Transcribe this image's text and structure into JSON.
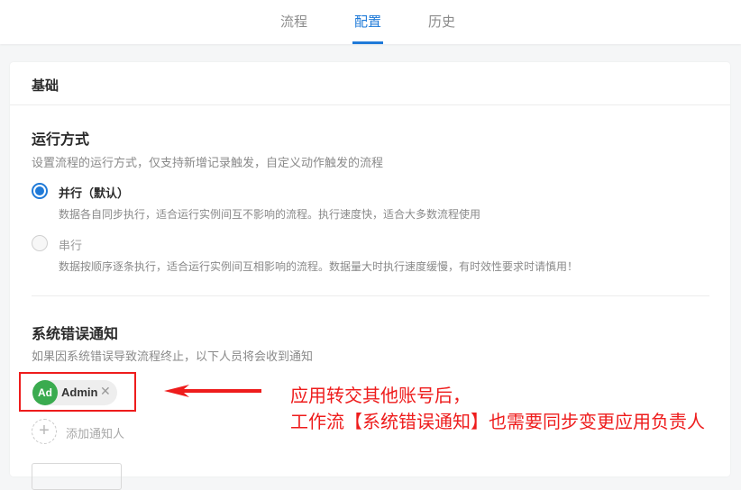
{
  "tabs": [
    {
      "label": "流程",
      "active": false
    },
    {
      "label": "配置",
      "active": true
    },
    {
      "label": "历史",
      "active": false
    }
  ],
  "accent_color": "#1f7ad8",
  "card": {
    "title": "基础",
    "run_mode": {
      "title": "运行方式",
      "desc": "设置流程的运行方式，仅支持新增记录触发，自定义动作触发的流程",
      "options": [
        {
          "label": "并行（默认）",
          "desc": "数据各自同步执行，适合运行实例间互不影响的流程。执行速度快，适合大多数流程使用",
          "checked": true
        },
        {
          "label": "串行",
          "desc": "数据按顺序逐条执行，适合运行实例间互相影响的流程。数据量大时执行速度缓慢，有时效性要求时请慎用！",
          "checked": false
        }
      ]
    },
    "error_notify": {
      "title": "系统错误通知",
      "desc": "如果因系统错误导致流程终止，以下人员将会收到通知",
      "user": {
        "initials": "Ad",
        "name": "Admin",
        "avatar_color": "#3aab4f"
      },
      "add_label": "添加通知人"
    }
  },
  "annotation": {
    "line1": "应用转交其他账号后，",
    "line2": "工作流【系统错误通知】也需要同步变更应用负责人",
    "color": "#ee1c1c"
  }
}
